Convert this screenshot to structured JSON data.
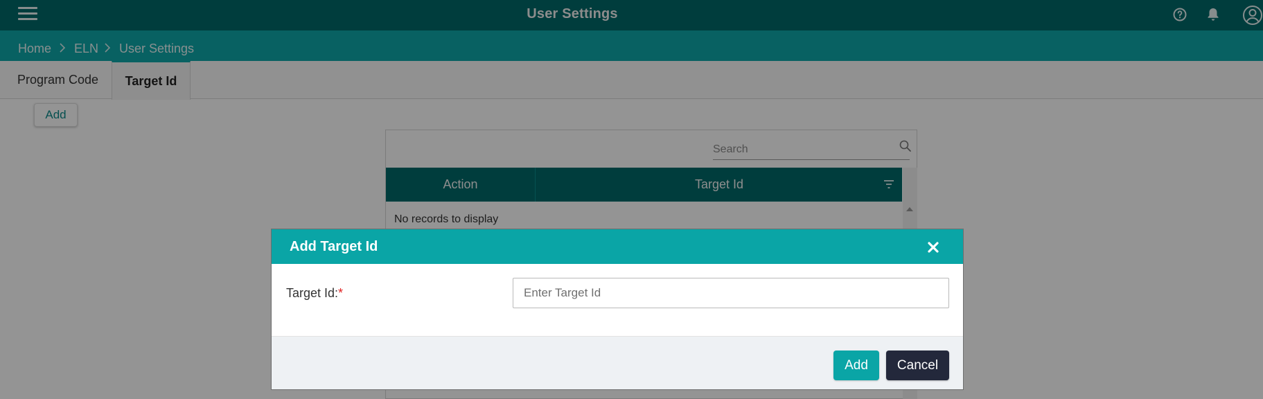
{
  "header": {
    "title": "User Settings",
    "icons": [
      "menu-icon",
      "help-icon",
      "bell-icon",
      "user-icon"
    ]
  },
  "breadcrumb": {
    "items": [
      "Home",
      "ELN",
      "User Settings"
    ]
  },
  "tabs": [
    {
      "label": "Program Code",
      "active": false
    },
    {
      "label": "Target Id",
      "active": true
    }
  ],
  "toolbar": {
    "add_label": "Add"
  },
  "grid": {
    "search_placeholder": "Search",
    "columns": [
      "Action",
      "Target Id"
    ],
    "empty_message": "No records to display"
  },
  "modal": {
    "title": "Add Target Id",
    "field_label": "Target Id:",
    "required_mark": "*",
    "input_placeholder": "Enter Target Id",
    "input_value": "",
    "add_label": "Add",
    "cancel_label": "Cancel"
  },
  "colors": {
    "header_bg": "#01696a",
    "breadcrumb_bg": "#0fa8a9",
    "accent": "#0aa5a6",
    "cancel_bg": "#23283b",
    "required": "#e02020"
  }
}
